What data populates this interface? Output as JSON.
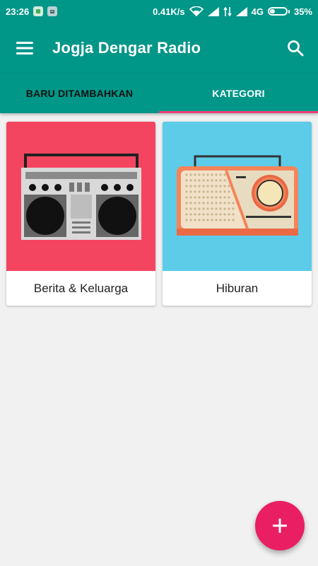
{
  "status_bar": {
    "time": "23:26",
    "speed": "0.41K/s",
    "network": "4G",
    "battery": "35%",
    "battery_level": 0.35
  },
  "app_bar": {
    "title": "Jogja Dengar Radio",
    "menu_icon": "hamburger-menu-icon",
    "search_icon": "search-icon"
  },
  "tabs": [
    {
      "label": "BARU DITAMBAHKAN",
      "active": false
    },
    {
      "label": "KATEGORI",
      "active": true
    }
  ],
  "categories": [
    {
      "label": "Berita & Keluarga",
      "image": "boombox-illustration",
      "bg_color": "#f44560"
    },
    {
      "label": "Hiburan",
      "image": "retro-radio-illustration",
      "bg_color": "#5ccce9"
    }
  ],
  "fab": {
    "icon": "plus-icon"
  },
  "colors": {
    "primary": "#009688",
    "accent": "#e91e63",
    "tab_indicator": "#ec407a",
    "background": "#f1f1f1"
  }
}
